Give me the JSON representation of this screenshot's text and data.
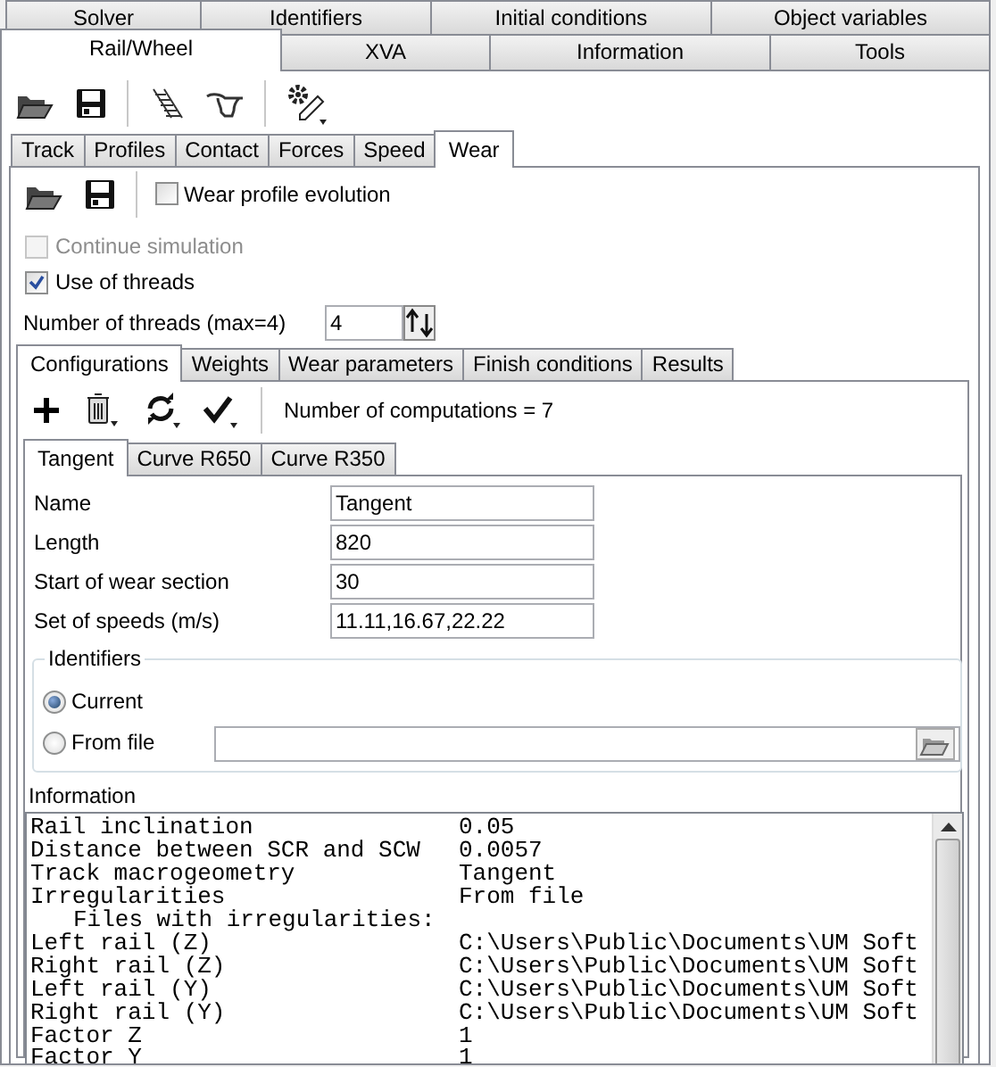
{
  "tab_rows": [
    {
      "tabs": [
        {
          "label": "Solver",
          "selected": false
        },
        {
          "label": "Identifiers",
          "selected": false
        },
        {
          "label": "Initial conditions",
          "selected": false
        },
        {
          "label": "Object variables",
          "selected": false
        }
      ]
    },
    {
      "tabs": [
        {
          "label": "Rail/Wheel",
          "selected": true
        },
        {
          "label": "XVA",
          "selected": false
        },
        {
          "label": "Information",
          "selected": false
        },
        {
          "label": "Tools",
          "selected": false
        }
      ]
    }
  ],
  "model_tabs": [
    {
      "label": "Track",
      "selected": false
    },
    {
      "label": "Profiles",
      "selected": false
    },
    {
      "label": "Contact",
      "selected": false
    },
    {
      "label": "Forces",
      "selected": false
    },
    {
      "label": "Speed",
      "selected": false
    },
    {
      "label": "Wear",
      "selected": true
    }
  ],
  "wear_toolbar": {
    "checkbox": {
      "label": "Wear profile evolution",
      "checked": false
    }
  },
  "options": [
    {
      "label": "Continue simulation",
      "checked": false,
      "disabled": true
    },
    {
      "label": "Use of threads",
      "checked": true,
      "disabled": false
    }
  ],
  "threads": {
    "label": "Number of threads (max=4)",
    "value": "4"
  },
  "config_tabs": [
    {
      "label": "Configurations",
      "selected": true
    },
    {
      "label": "Weights",
      "selected": false
    },
    {
      "label": "Wear parameters",
      "selected": false
    },
    {
      "label": "Finish conditions",
      "selected": false
    },
    {
      "label": "Results",
      "selected": false
    }
  ],
  "computations": "Number of computations = 7",
  "case_tabs": [
    {
      "label": "Tangent",
      "selected": true
    },
    {
      "label": "Curve R650",
      "selected": false
    },
    {
      "label": "Curve R350",
      "selected": false
    }
  ],
  "fields": [
    {
      "label": "Name",
      "value": "Tangent"
    },
    {
      "label": "Length",
      "value": "820"
    },
    {
      "label": "Start of wear section",
      "value": "30"
    },
    {
      "label": "Set of speeds (m/s)",
      "value": "11.11,16.67,22.22"
    }
  ],
  "identifiers": {
    "title": "Identifiers",
    "options": [
      {
        "label": "Current",
        "selected": true
      },
      {
        "label": "From file",
        "selected": false
      }
    ]
  },
  "information": {
    "title": "Information",
    "lines": [
      {
        "label": "Rail inclination",
        "value": "0.05",
        "indented": false
      },
      {
        "label": "Distance between SCR and SCW",
        "value": "0.0057",
        "indented": false
      },
      {
        "label": "Track macrogeometry",
        "value": "Tangent",
        "indented": false
      },
      {
        "label": "Irregularities",
        "value": "From file",
        "indented": false
      },
      {
        "label": "Files with irregularities:",
        "indented": true
      },
      {
        "label": "Left rail (Z)",
        "value": "C:\\Users\\Public\\Documents\\UM Soft",
        "indented": false
      },
      {
        "label": "Right rail (Z)",
        "value": "C:\\Users\\Public\\Documents\\UM Soft",
        "indented": false
      },
      {
        "label": "Left rail (Y)",
        "value": "C:\\Users\\Public\\Documents\\UM Soft",
        "indented": false
      },
      {
        "label": "Right rail (Y)",
        "value": "C:\\Users\\Public\\Documents\\UM Soft",
        "indented": false
      },
      {
        "label": "Factor Z",
        "value": "1",
        "indented": false
      },
      {
        "label": "Factor Y",
        "value": "1",
        "indented": false
      }
    ]
  }
}
